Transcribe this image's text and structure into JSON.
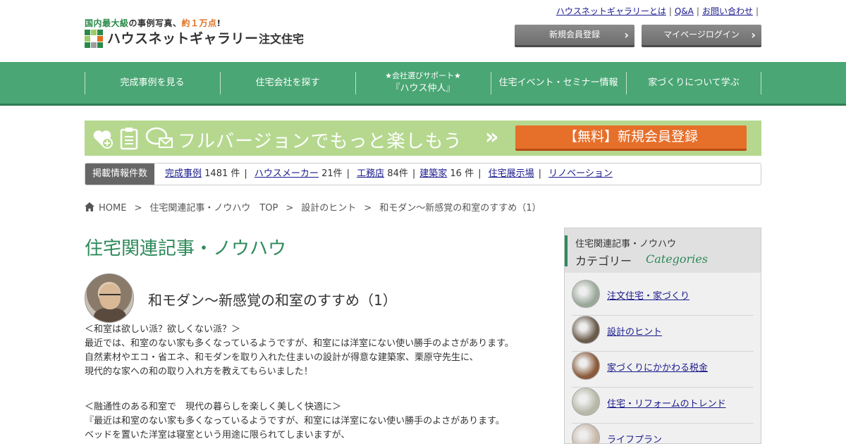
{
  "header": {
    "tagline_parts": [
      "国内最大級",
      "の事例写真、",
      "約１万点",
      "!"
    ],
    "logo_name": "ハウスネットギャラリー",
    "logo_sub": "注文住宅",
    "logo_colors": [
      "#2a8a4a",
      "#9ccc65",
      "#2a8a4a",
      "#9ccc65",
      "#ffffff",
      "#e07020",
      "#2a8a4a",
      "#9e9e9e",
      "#2a8a4a"
    ],
    "top_links": [
      "ハウスネットギャラリーとは",
      "Q&A",
      "お問い合わせ"
    ],
    "register_button": "新規会員登録",
    "login_button": "マイページログイン"
  },
  "nav": {
    "items": [
      {
        "label": "完成事例を見る"
      },
      {
        "label": "住宅会社を探す"
      },
      {
        "label_small": "★会社選びサポート★",
        "label": "『ハウス仲人』"
      },
      {
        "label": "住宅イベント・セミナー情報"
      },
      {
        "label": "家づくりについて学ぶ"
      }
    ]
  },
  "banner": {
    "text": "フルバージョンでもっと楽しもう",
    "chevron": "»",
    "button": "【無料】新規会員登録",
    "bg_color": "#b5d88e",
    "button_color": "#e66f2a"
  },
  "counts": {
    "label": "掲載情報件数",
    "items": [
      {
        "link": "完成事例",
        "count": "1481 件"
      },
      {
        "link": "ハウスメーカー",
        "count": "21件"
      },
      {
        "link": "工務店",
        "count": "84件"
      },
      {
        "link": "建築家",
        "count": "16 件"
      },
      {
        "link": "住宅展示場",
        "count": ""
      },
      {
        "link": "リノベーション",
        "count": ""
      }
    ]
  },
  "breadcrumb": [
    "HOME",
    "住宅関連記事・ノウハウ　TOP",
    "設計のヒント",
    "和モダン～新感覚の和室のすすめ（1）"
  ],
  "main": {
    "section_title": "住宅関連記事・ノウハウ",
    "article_title": "和モダン～新感覚の和室のすすめ（1）",
    "paragraph1": [
      "＜和室は欲しい派？欲しくない派？＞",
      "最近では、和室のない家も多くなっているようですが、和室には洋室にない使い勝手のよさがあります。",
      "自然素材やエコ・省エネ、和モダンを取り入れた住まいの設計が得意な建築家、栗原守先生に、",
      "現代的な家への和の取り入れ方を教えてもらいました！"
    ],
    "paragraph2": [
      "＜融通性のある和室で　現代の暮らしを楽しく美しく快適に＞",
      "『最近は和室のない家も多くなっているようですが、和室には洋室にない使い勝手のよさがあります。",
      "ベッドを置いた洋室は寝室という用途に限られてしまいますが、"
    ]
  },
  "sidebar": {
    "title": "住宅関連記事・ノウハウ",
    "subtitle": "カテゴリー",
    "subtitle_en": "Categories",
    "categories": [
      {
        "name": "注文住宅・家づくり",
        "thumb": "#9aa89a"
      },
      {
        "name": "設計のヒント",
        "thumb": "#6a5a4a"
      },
      {
        "name": "家づくりにかかわる税金",
        "thumb": "#8a5a3a"
      },
      {
        "name": "住宅・リフォームのトレンド",
        "thumb": "#b8b8a8"
      },
      {
        "name": "ライフプラン",
        "thumb": "#c8b8a8"
      }
    ]
  }
}
